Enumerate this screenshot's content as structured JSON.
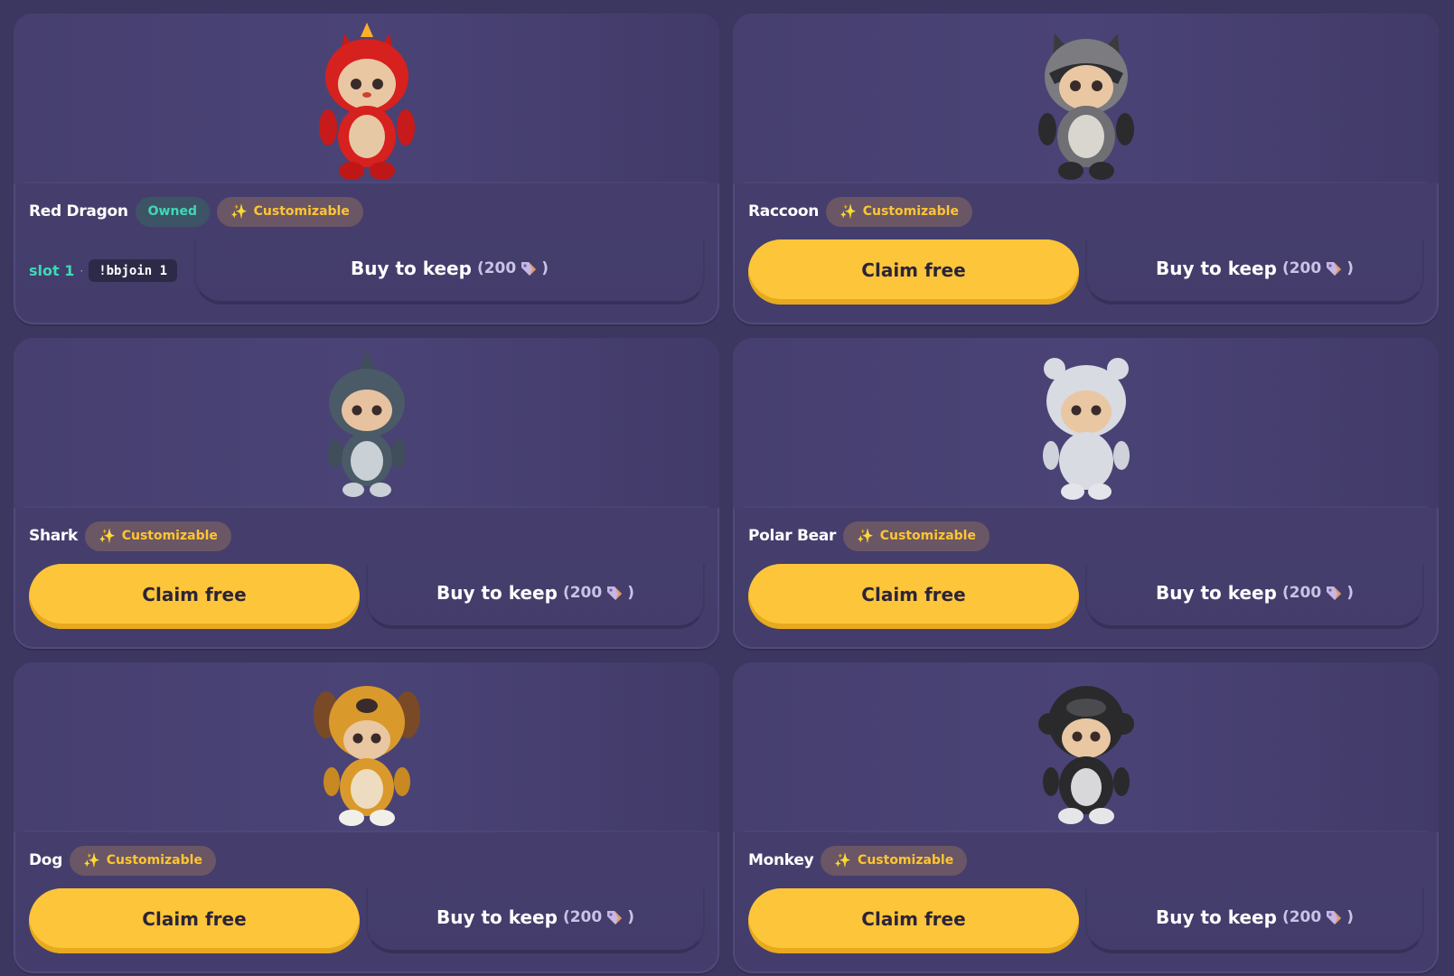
{
  "labels": {
    "owned": "Owned",
    "customizable": "Customizable",
    "claim": "Claim free",
    "buy": "Buy to keep",
    "price_open": "(200",
    "price_close": ")",
    "slot": "slot 1",
    "slot_sep": "·",
    "command": "!bbjoin 1"
  },
  "cards": [
    {
      "name": "Red Dragon",
      "owned": true
    },
    {
      "name": "Raccoon"
    },
    {
      "name": "Shark"
    },
    {
      "name": "Polar Bear"
    },
    {
      "name": "Dog"
    },
    {
      "name": "Monkey"
    }
  ],
  "colors": {
    "background": "#3b3760",
    "card": "#4a4274",
    "claim_button": "#fdc53a",
    "owned_text": "#3ed9b5",
    "customizable_text": "#ffc533"
  },
  "icons": {
    "sparkle": "sparkle-icon",
    "price_tag": "price-tag-icon"
  }
}
